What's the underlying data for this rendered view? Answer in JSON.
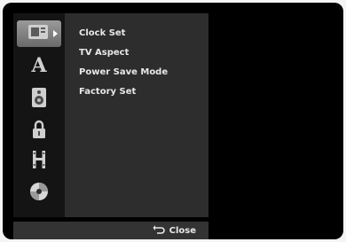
{
  "menu": {
    "icons": [
      {
        "name": "general-settings-icon",
        "selected": true
      },
      {
        "name": "language-icon",
        "glyph": "A"
      },
      {
        "name": "audio-icon"
      },
      {
        "name": "lock-icon"
      },
      {
        "name": "recording-icon"
      },
      {
        "name": "disc-icon"
      }
    ],
    "items": [
      "Clock Set",
      "TV Aspect",
      "Power Save Mode",
      "Factory Set"
    ]
  },
  "footer": {
    "close_label": "Close"
  }
}
